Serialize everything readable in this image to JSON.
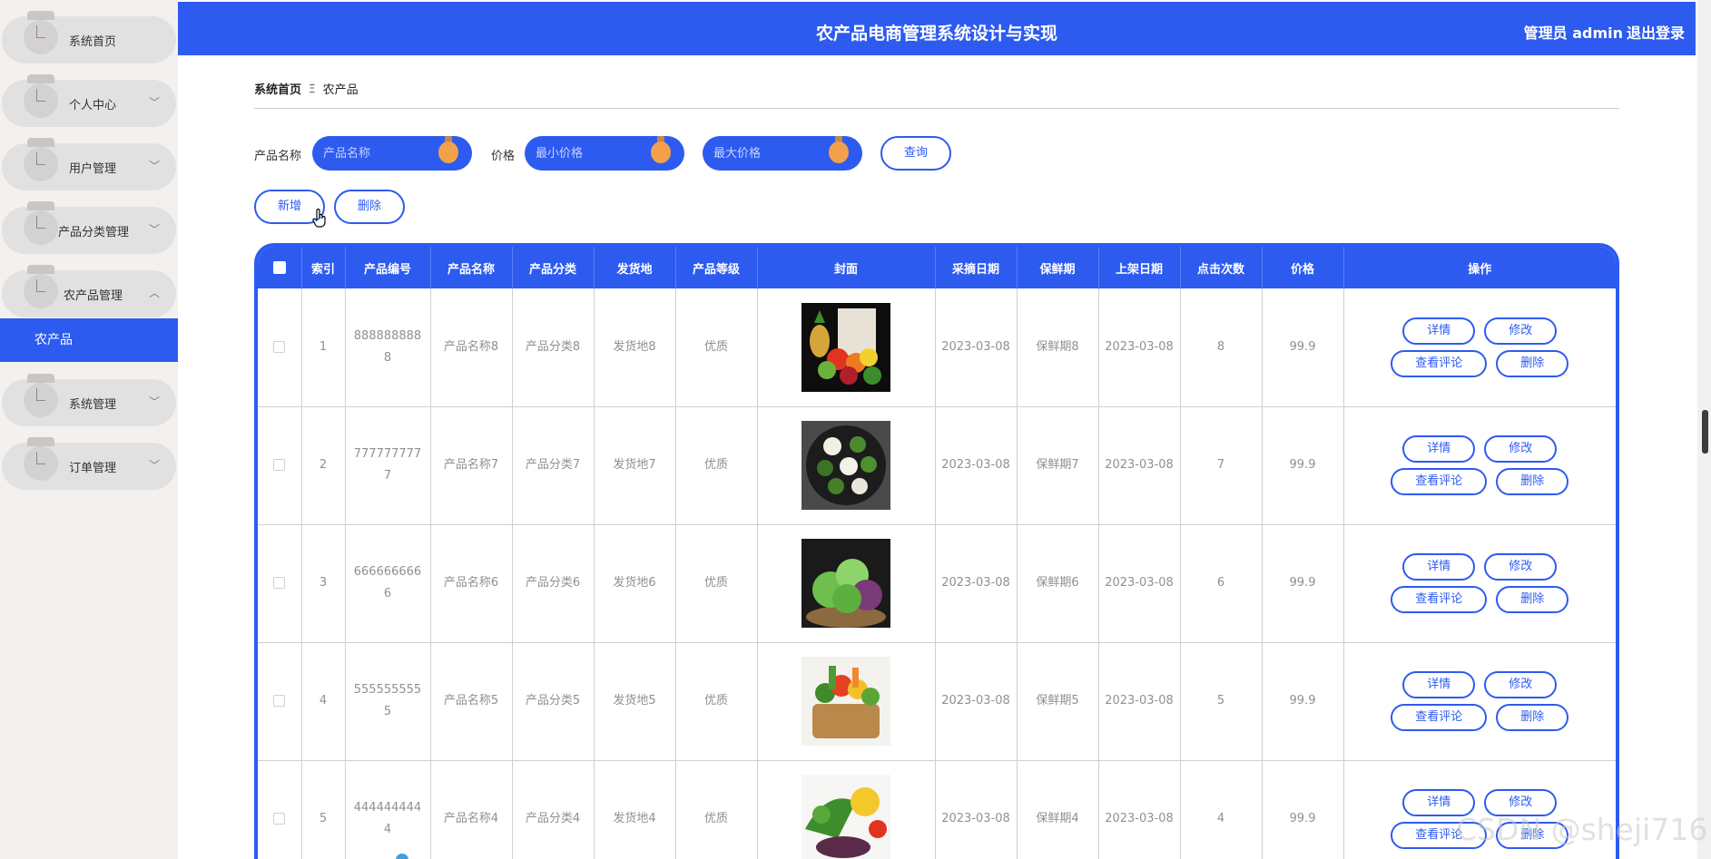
{
  "header": {
    "title": "农产品电商管理系统设计与实现",
    "user": "管理员 admin",
    "logout": "退出登录"
  },
  "sidebar": {
    "items": [
      {
        "label": "系统首页",
        "has_chevron": false,
        "chevron": ""
      },
      {
        "label": "个人中心",
        "has_chevron": true,
        "chevron": "﹀"
      },
      {
        "label": "用户管理",
        "has_chevron": true,
        "chevron": "﹀"
      },
      {
        "label": "产品分类管理",
        "has_chevron": true,
        "chevron": "﹀"
      },
      {
        "label": "农产品管理",
        "has_chevron": true,
        "chevron": "︿"
      }
    ],
    "active_sub": "农产品",
    "items_after": [
      {
        "label": "系统管理",
        "chevron": "﹀"
      },
      {
        "label": "订单管理",
        "chevron": "﹀"
      }
    ]
  },
  "breadcrumb": {
    "home": "系统首页",
    "separator": "Ξ",
    "current": "农产品"
  },
  "search": {
    "name_label": "产品名称",
    "name_placeholder": "产品名称",
    "price_label": "价格",
    "min_placeholder": "最小价格",
    "max_placeholder": "最大价格",
    "query_button": "查询"
  },
  "actions": {
    "add": "新增",
    "delete": "删除"
  },
  "table": {
    "columns": [
      "索引",
      "产品编号",
      "产品名称",
      "产品分类",
      "发货地",
      "产品等级",
      "封面",
      "采摘日期",
      "保鲜期",
      "上架日期",
      "点击次数",
      "价格",
      "操作"
    ],
    "ops": {
      "detail": "详情",
      "edit": "修改",
      "reviews": "查看评论",
      "delete": "删除"
    },
    "rows": [
      {
        "index": "1",
        "code": "8888888888",
        "name": "产品名称8",
        "category": "产品分类8",
        "origin": "发货地8",
        "grade": "优质",
        "pick_date": "2023-03-08",
        "shelf_life": "保鲜期8",
        "list_date": "2023-03-08",
        "clicks": "8",
        "price": "99.9"
      },
      {
        "index": "2",
        "code": "7777777777",
        "name": "产品名称7",
        "category": "产品分类7",
        "origin": "发货地7",
        "grade": "优质",
        "pick_date": "2023-03-08",
        "shelf_life": "保鲜期7",
        "list_date": "2023-03-08",
        "clicks": "7",
        "price": "99.9"
      },
      {
        "index": "3",
        "code": "6666666666",
        "name": "产品名称6",
        "category": "产品分类6",
        "origin": "发货地6",
        "grade": "优质",
        "pick_date": "2023-03-08",
        "shelf_life": "保鲜期6",
        "list_date": "2023-03-08",
        "clicks": "6",
        "price": "99.9"
      },
      {
        "index": "4",
        "code": "5555555555",
        "name": "产品名称5",
        "category": "产品分类5",
        "origin": "发货地5",
        "grade": "优质",
        "pick_date": "2023-03-08",
        "shelf_life": "保鲜期5",
        "list_date": "2023-03-08",
        "clicks": "5",
        "price": "99.9"
      },
      {
        "index": "5",
        "code": "4444444444",
        "name": "产品名称4",
        "category": "产品分类4",
        "origin": "发货地4",
        "grade": "优质",
        "pick_date": "2023-03-08",
        "shelf_life": "保鲜期4",
        "list_date": "2023-03-08",
        "clicks": "4",
        "price": "99.9"
      }
    ]
  },
  "watermark": "CSDN @sheji716",
  "colors": {
    "accent": "#2d5bf0",
    "knob": "#f2a14a",
    "sidebar_bg": "#f3f0ee"
  }
}
